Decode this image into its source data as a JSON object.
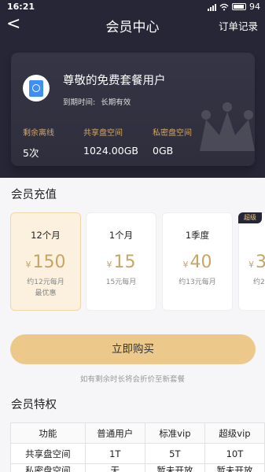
{
  "status_bar": {
    "time": "16:21",
    "battery": "94"
  },
  "nav": {
    "back": "<",
    "title": "会员中心",
    "orders": "订单记录"
  },
  "card": {
    "name": "尊敬的免费套餐用户",
    "expiry_label": "到期时间:",
    "expiry_value": "长期有效",
    "stats": [
      {
        "label": "剩余离线",
        "value": "5次"
      },
      {
        "label": "共享盘空间",
        "value": "1024.00GB"
      },
      {
        "label": "私密盘空间",
        "value": "0GB"
      }
    ]
  },
  "recharge": {
    "title": "会员充值",
    "plans": [
      {
        "name": "12个月",
        "currency": "¥",
        "price": "150",
        "per": "约12元每月",
        "note": "最优惠",
        "selected": true
      },
      {
        "name": "1个月",
        "currency": "¥",
        "price": "15",
        "per": "15元每月",
        "note": ""
      },
      {
        "name": "1季度",
        "currency": "¥",
        "price": "40",
        "per": "约13元每月",
        "note": ""
      },
      {
        "name": "",
        "currency": "¥",
        "price": "3",
        "per": "约2",
        "note": "",
        "badge": "超级"
      }
    ]
  },
  "buy_button": "立即购买",
  "hint": "如有剩余时长将会折价至新套餐",
  "privileges": {
    "title": "会员特权",
    "headers": [
      "功能",
      "普通用户",
      "标准vip",
      "超级vip"
    ],
    "rows": [
      [
        "共享盘空间",
        "1T",
        "5T",
        "10T"
      ],
      [
        "私密盘空间",
        "无",
        "暂未开放",
        "暂未开放"
      ]
    ]
  }
}
